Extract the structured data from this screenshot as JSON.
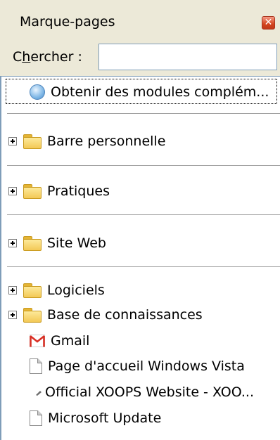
{
  "panel": {
    "title": "Marque-pages",
    "close_icon": "close-icon"
  },
  "search": {
    "label_prefix": "C",
    "label_underlined": "h",
    "label_suffix": "ercher :",
    "value": "",
    "placeholder": ""
  },
  "bookmarks": {
    "addons": "Obtenir des modules complém...",
    "folders": [
      "Barre personnelle",
      "Pratiques",
      "Site Web",
      "Logiciels",
      "Base de connaissances"
    ],
    "links": [
      {
        "label": "Gmail",
        "icon": "gmail-icon"
      },
      {
        "label": "Page d'accueil Windows Vista",
        "icon": "page-icon"
      },
      {
        "label": "Official XOOPS Website - XOO...",
        "icon": "small-favicon-icon"
      },
      {
        "label": "Microsoft Update",
        "icon": "page-icon"
      }
    ]
  },
  "colors": {
    "panel_background": "#ece9d8",
    "close_button": "#d4451f",
    "folder": "#f3c956",
    "input_border": "#7f9db9"
  }
}
